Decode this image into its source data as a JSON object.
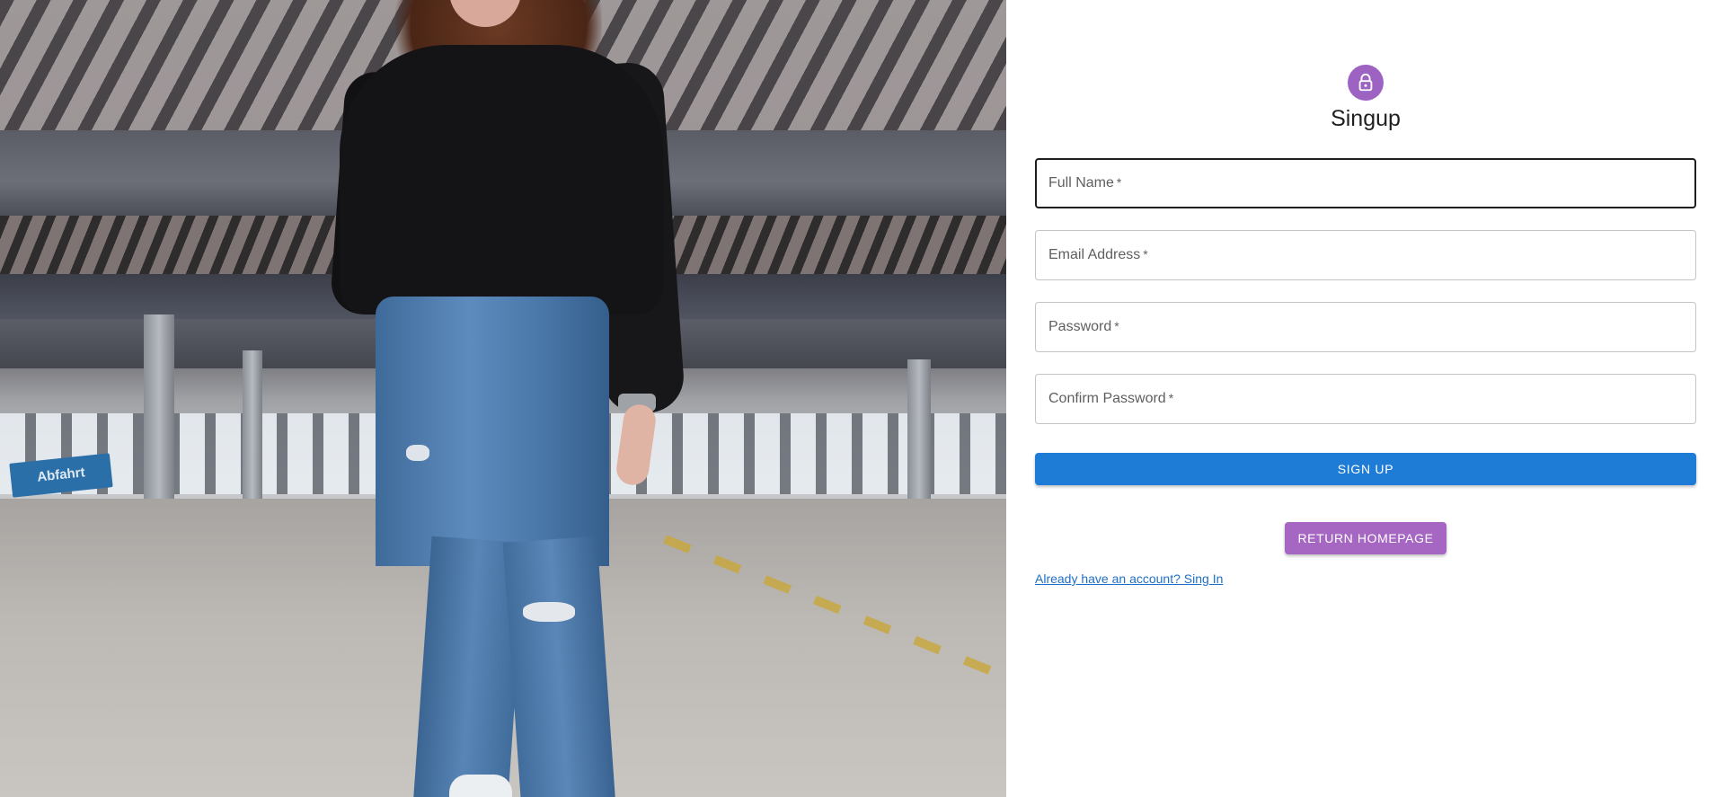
{
  "hero": {
    "sign_text": "Abfahrt"
  },
  "form": {
    "title": "Singup",
    "fields": [
      {
        "label": "Full Name",
        "required_mark": "*"
      },
      {
        "label": "Email Address",
        "required_mark": "*"
      },
      {
        "label": "Password",
        "required_mark": "*"
      },
      {
        "label": "Confirm Password",
        "required_mark": "*"
      }
    ],
    "signup_label": "SIGN UP",
    "return_home_label": "RETURN HOMEPAGE",
    "signin_link": "Already have an account? Sing In"
  },
  "colors": {
    "avatar_bg": "#9c63c2",
    "primary": "#1f7cd6",
    "secondary": "#a567c2",
    "link": "#1f6fc4"
  },
  "icons": {
    "avatar": "lock-icon"
  }
}
